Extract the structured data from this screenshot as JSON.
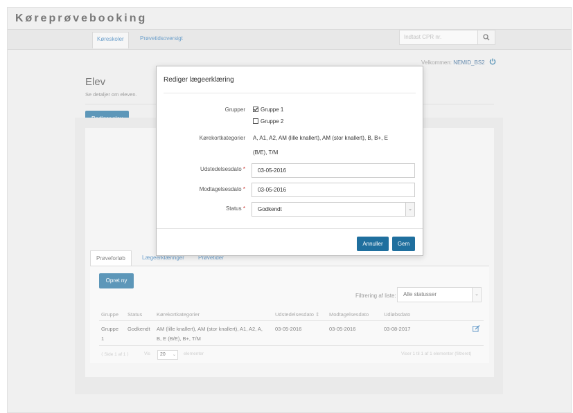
{
  "app_title": "Køreprøvebooking",
  "nav": {
    "tabs": [
      "Køreskoler",
      "Prøvetidsoversigt"
    ],
    "search_placeholder": "Indtast CPR nr."
  },
  "header": {
    "welcome": "Velkommen:",
    "user": "NEMID_BS2"
  },
  "page": {
    "title": "Elev",
    "subtitle": "Se detaljer om eleven.",
    "edit_button": "Rediger elev"
  },
  "tabs": {
    "items": [
      "Prøveforløb",
      "Lægeerklæringer",
      "Prøvetider"
    ],
    "new_button": "Opret ny"
  },
  "table": {
    "filter_label": "Filtrering af liste:",
    "filter_value": "Alle statusser",
    "headers": [
      "Gruppe",
      "Status",
      "Kørekortkategorier",
      "Udstedelsesdato",
      "Modtagelsesdato",
      "Udløbsdato"
    ],
    "rows": [
      {
        "gruppe_line1": "Gruppe",
        "gruppe_line2": "1",
        "status": "Godkendt",
        "kategorier_line1": "AM (lille knallert), AM (stor knallert), A1, A2, A,",
        "kategorier_line2": "B, E (B/E), B+, T/M",
        "udstedelse": "03-05-2016",
        "modtagelse": "03-05-2016",
        "udlob": "03-08-2017"
      }
    ],
    "pager": {
      "info": "Side 1 af 1",
      "show": "Vis",
      "per_page": "20",
      "elements": "elementer",
      "range": "Viser 1 til 1 af 1 elementer",
      "filtered": "(filtreret)"
    }
  },
  "modal": {
    "title": "Rediger lægeerklæring",
    "groups_label": "Grupper",
    "groups": [
      {
        "label": "Gruppe 1",
        "checked": true
      },
      {
        "label": "Gruppe 2",
        "checked": false
      }
    ],
    "categories_label": "Kørekortkategorier",
    "categories_line1": "A, A1, A2, AM (lille knallert), AM (stor knallert), B, B+, E",
    "categories_line2": "(B/E), T/M",
    "issue_label": "Udstedelsesdato",
    "issue_value": "03-05-2016",
    "received_label": "Modtagelsesdato",
    "received_value": "03-05-2016",
    "status_label": "Status",
    "status_value": "Godkendt",
    "cancel_button": "Annuller",
    "save_button": "Gem"
  },
  "colors": {
    "primary": "#1f6f9e",
    "link": "#337ab7",
    "required": "#c9302c"
  }
}
